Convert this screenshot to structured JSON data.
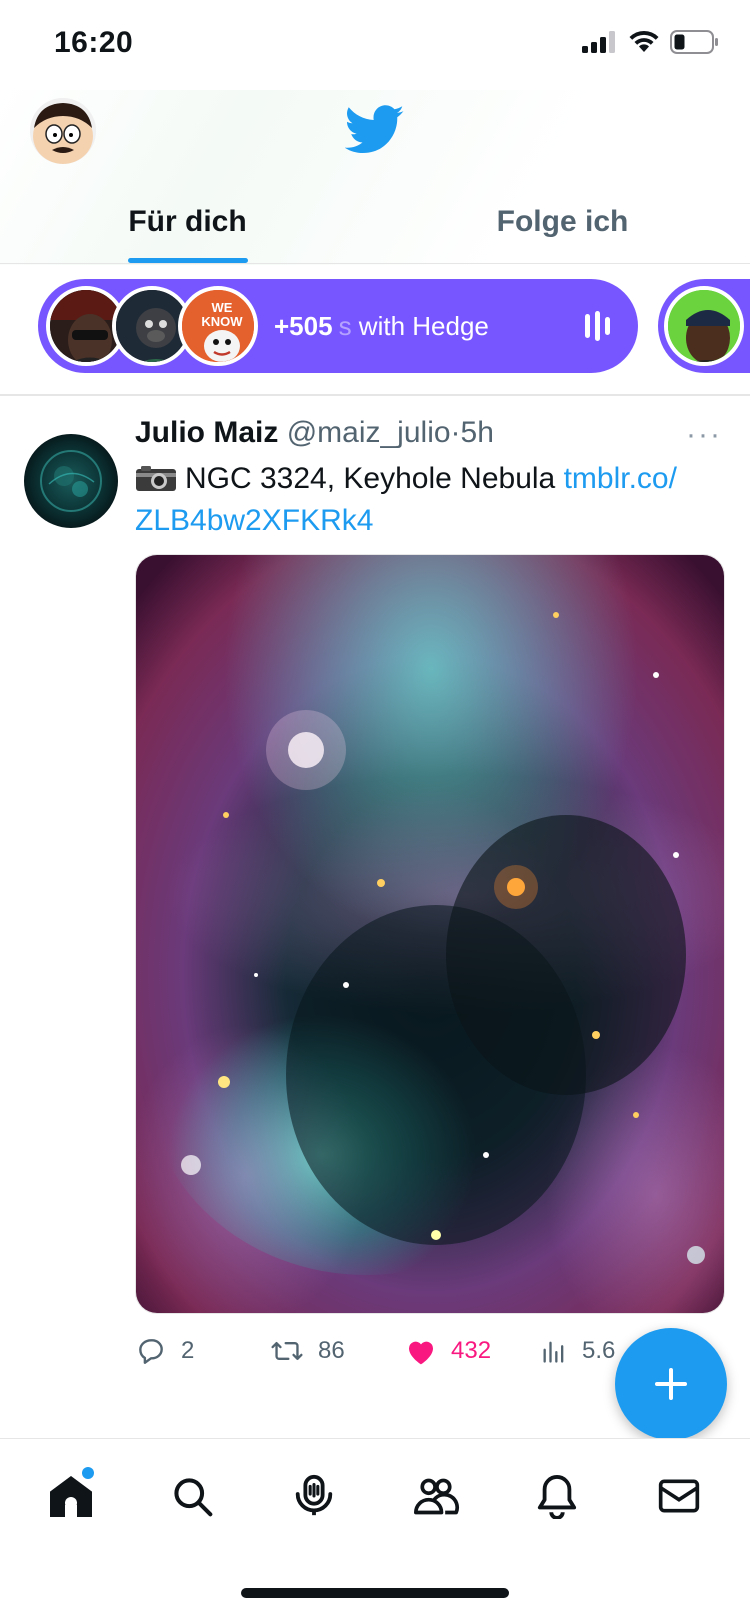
{
  "status_bar": {
    "time": "16:20",
    "icons": [
      "cellular-signal-icon",
      "wifi-icon",
      "battery-icon"
    ]
  },
  "header": {
    "logo": "twitter-bird-icon",
    "profile_avatar": "avatar"
  },
  "tabs": [
    {
      "label": "Für dich",
      "active": true
    },
    {
      "label": "Folge ich",
      "active": false
    }
  ],
  "spaces": {
    "listener_count": "+505",
    "title_hidden": "s",
    "title": " with Hedge"
  },
  "tweet": {
    "name": "Julio Maiz",
    "handle": "@maiz_julio",
    "separator": "·",
    "time": "5h",
    "more": "···",
    "text": "NGC 3324, Keyhole Nebula",
    "link_part1": "tmblr.co/",
    "link_part2": "ZLB4bw2XFKRk4",
    "actions": {
      "replies": "2",
      "retweets": "86",
      "likes": "432",
      "views": "5.6"
    }
  },
  "colors": {
    "accent": "#1d9bf0",
    "spaces": "#7856ff",
    "like": "#f91880",
    "secondary_text": "#536471"
  },
  "bottom_nav": [
    "home-icon",
    "search-icon",
    "spaces-icon",
    "communities-icon",
    "notifications-icon",
    "messages-icon"
  ]
}
